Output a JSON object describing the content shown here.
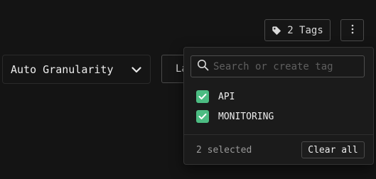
{
  "header": {
    "tags_button_label": "2 Tags"
  },
  "controls": {
    "granularity_label": "Auto Granularity",
    "partial_button_label": "Last"
  },
  "tag_popover": {
    "search_placeholder": "Search or create tag",
    "search_value": "",
    "options": [
      {
        "label": "API",
        "checked": true
      },
      {
        "label": "MONITORING",
        "checked": true
      }
    ],
    "selected_count_text": "2 selected",
    "clear_all_label": "Clear all"
  },
  "colors": {
    "background": "#141414",
    "checkbox_accent": "#4cbc82",
    "border": "#4a4a4a"
  },
  "icons": {
    "tags_button": "tag-icon",
    "more_button": "more-vertical-icon",
    "granularity": "chevron-down-icon",
    "search": "search-icon",
    "checkbox": "check-icon"
  }
}
